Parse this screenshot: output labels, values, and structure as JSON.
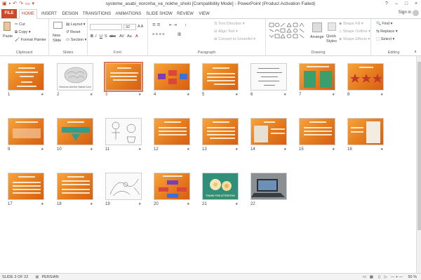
{
  "window": {
    "title": "systeme_asabi_noronha_va_nokhe_shoki [Compatibility Mode] - PowerPoint (Product Activation Failed)",
    "controls": [
      "?",
      "–",
      "□",
      "×"
    ]
  },
  "tabs": [
    {
      "label": "FILE"
    },
    {
      "label": "HOME"
    },
    {
      "label": "INSERT"
    },
    {
      "label": "DESIGN"
    },
    {
      "label": "TRANSITIONS"
    },
    {
      "label": "ANIMATIONS"
    },
    {
      "label": "SLIDE SHOW"
    },
    {
      "label": "REVIEW"
    },
    {
      "label": "VIEW"
    }
  ],
  "account": {
    "label": "Sign in"
  },
  "ribbon": {
    "clipboard": {
      "label": "Clipboard",
      "paste": "Paste",
      "cut": "Cut",
      "copy": "Copy",
      "format_painter": "Format Painter"
    },
    "slides": {
      "label": "Slides",
      "new_slide": "New",
      "new_slide2": "Slide",
      "layout": "Layout",
      "reset": "Reset",
      "section": "Section"
    },
    "font": {
      "label": "Font",
      "size": "32"
    },
    "paragraph": {
      "label": "Paragraph",
      "text_direction": "Text Direction",
      "align_text": "Align Text",
      "smartart": "Convert to SmartArt"
    },
    "drawing": {
      "label": "Drawing",
      "arrange": "Arrange",
      "quick_styles": "Quick",
      "quick_styles2": "Styles",
      "shape_fill": "Shape Fill",
      "shape_outline": "Shape Outline",
      "shape_effects": "Shape Effects"
    },
    "editing": {
      "label": "Editing",
      "find": "Find",
      "replace": "Replace",
      "select": "Select"
    }
  },
  "slides": [
    {
      "num": "1"
    },
    {
      "num": "2"
    },
    {
      "num": "3"
    },
    {
      "num": "4"
    },
    {
      "num": "5"
    },
    {
      "num": "6"
    },
    {
      "num": "7"
    },
    {
      "num": "8"
    },
    {
      "num": "9"
    },
    {
      "num": "10"
    },
    {
      "num": "11"
    },
    {
      "num": "12"
    },
    {
      "num": "13"
    },
    {
      "num": "14"
    },
    {
      "num": "15"
    },
    {
      "num": "16"
    },
    {
      "num": "17"
    },
    {
      "num": "18"
    },
    {
      "num": "19"
    },
    {
      "num": "20"
    },
    {
      "num": "21"
    },
    {
      "num": "22"
    }
  ],
  "slide_captions": {
    "s2": "Neurons and the Spinal Cord",
    "s21": "THANK FOR ATTENTION"
  },
  "status": {
    "slide_pos": "SLIDE 3 OF 22",
    "language": "PERSIAN",
    "zoom": "50 %"
  },
  "colors": {
    "accent": "#d04727",
    "slide_orange": "#e57b1e"
  }
}
